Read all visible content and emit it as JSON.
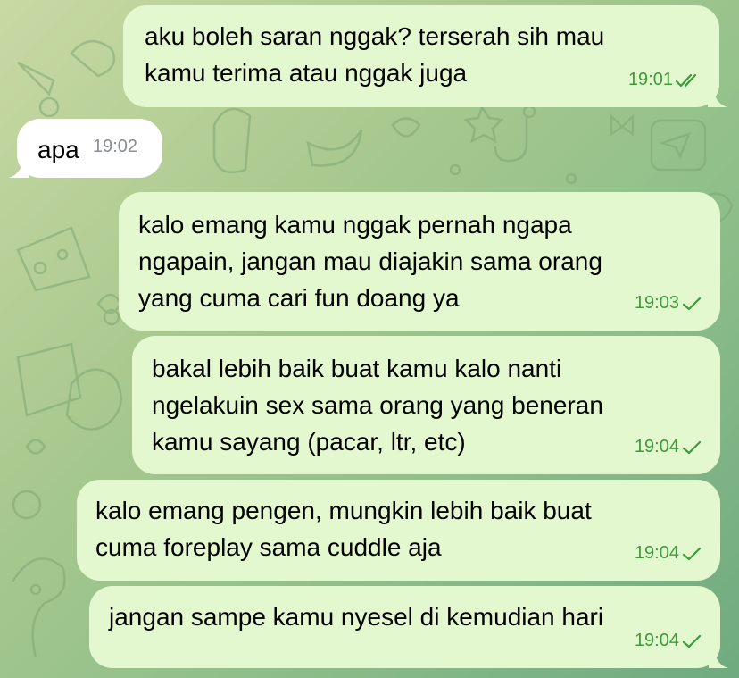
{
  "chat": {
    "messages": [
      {
        "text_lines": [
          "aku boleh saran nggak? terserah sih mau",
          "kamu terima atau nggak juga"
        ],
        "time": "19:01",
        "direction": "outgoing",
        "status": "read"
      },
      {
        "text_lines": [
          "apa"
        ],
        "time": "19:02",
        "direction": "incoming"
      },
      {
        "text_lines": [
          "kalo emang kamu nggak pernah ngapa",
          "ngapain, jangan mau diajakin sama orang",
          "yang cuma cari fun doang ya"
        ],
        "time": "19:03",
        "direction": "outgoing",
        "status": "sent"
      },
      {
        "text_lines": [
          "bakal lebih baik buat kamu kalo nanti",
          "ngelakuin sex sama orang yang beneran",
          "kamu sayang (pacar, ltr, etc)"
        ],
        "time": "19:04",
        "direction": "outgoing",
        "status": "sent"
      },
      {
        "text_lines": [
          "kalo emang pengen, mungkin lebih baik buat",
          "cuma foreplay sama cuddle aja"
        ],
        "time": "19:04",
        "direction": "outgoing",
        "status": "sent"
      },
      {
        "text_lines": [
          "jangan sampe kamu nyesel di kemudian hari"
        ],
        "time": "19:04",
        "direction": "outgoing",
        "status": "sent"
      }
    ]
  },
  "colors": {
    "outgoing_bubble": "#e3f8cf",
    "incoming_bubble": "#ffffff",
    "check_green": "#3d9b3a",
    "time_grey": "#8a8f94"
  },
  "icons": {
    "read_status": "double-check-icon",
    "sent_status": "check-icon"
  }
}
